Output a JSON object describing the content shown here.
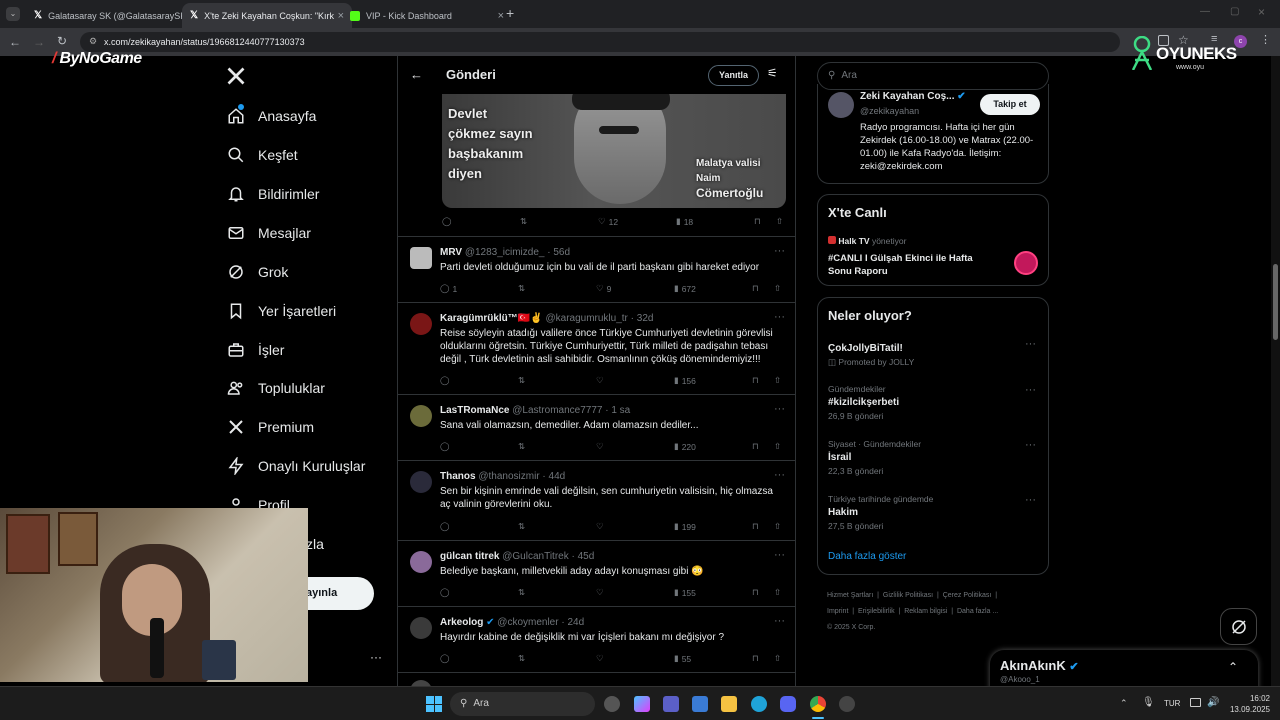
{
  "browser": {
    "tabs": [
      {
        "title": "Galatasaray SK (@GalatasaraySK)",
        "active": false
      },
      {
        "title": "X'te Zeki Kayahan Coşkun: \"Kırk",
        "active": true
      },
      {
        "title": "VIP - Kick Dashboard",
        "active": false
      }
    ],
    "url": "x.com/zekikayahan/status/1966812440777130373"
  },
  "overlays": {
    "bynogame_logo": "ByNoGame",
    "oyuneks_logo": "OYUNEKS",
    "oyuneks_sub": "www.oyu"
  },
  "nav": {
    "items": [
      "Anasayfa",
      "Keşfet",
      "Bildirimler",
      "Mesajlar",
      "Grok",
      "Yer İşaretleri",
      "İşler",
      "Topluluklar",
      "Premium",
      "Onaylı Kuruluşlar",
      "Profil",
      "zla"
    ],
    "post_button": "ayınla",
    "more": "···"
  },
  "main": {
    "header_title": "Gönderi",
    "reply_button": "Yanıtla",
    "image_text_left": [
      "Devlet",
      "çökmez sayın",
      "başbakanım",
      "diyen"
    ],
    "image_text_right": [
      "Malatya valisi",
      "Naim",
      "Cömertoğlu"
    ],
    "post_stats": {
      "likes": "12",
      "views": "18"
    },
    "replies": [
      {
        "name": "MRV",
        "handle": "@1283_icimizde_ · 56d",
        "text": "Parti devleti olduğumuz için bu vali de il parti başkanı gibi hareket ediyor",
        "replies": "1",
        "likes": "9",
        "views": "672"
      },
      {
        "name": "Karagümrüklü™🇹🇷✌",
        "handle": "@karagumruklu_tr · 32d",
        "text": "Reise söyleyin atadığı valilere önce Türkiye Cumhuriyeti devletinin görevlisi olduklarını öğretsin. Türkiye Cumhuriyettir, Türk milleti de padişahın tebası değil , Türk devletinin asli sahibidir. Osmanlının çöküş dönemindemiyiz!!!",
        "replies": "",
        "likes": "",
        "views": "156"
      },
      {
        "name": "LasTRomaNce",
        "handle": "@Lastromance7777 · 1 sa",
        "text": "Sana vali olamazsın, demediler. Adam olamazsın dediler...",
        "replies": "",
        "likes": "",
        "views": "220"
      },
      {
        "name": "Thanos",
        "handle": "@thanosizmir · 44d",
        "text": "Sen bir kişinin emrinde vali değilsin, sen cumhuriyetin valisisin, hiç olmazsa aç valinin görevlerini oku.",
        "replies": "",
        "likes": "",
        "views": "199"
      },
      {
        "name": "gülcan titrek",
        "handle": "@GulcanTitrek · 45d",
        "text": "Belediye başkanı, milletvekili  aday adayı konuşması gibi 😳",
        "replies": "",
        "likes": "",
        "views": "155"
      },
      {
        "name": "Arkeolog",
        "handle": "@ckoymenler · 24d",
        "text": "Hayırdır kabine de değişiklik mi var  İçişleri bakanı mı değişiyor ?",
        "replies": "",
        "likes": "",
        "views": "55"
      }
    ]
  },
  "sidebar": {
    "search_placeholder": "Ara",
    "profile": {
      "name": "Zeki Kayahan Coş...",
      "handle": "@zekikayahan",
      "follow": "Takip et",
      "bio": "Radyo programcısı. Hafta içi her gün Zekirdek (16.00-18.00) ve Matrax (22.00-01.00) ile Kafa Radyo'da. İletişim: zeki@zekirdek.com"
    },
    "live": {
      "title": "X'te Canlı",
      "host": "Halk TV",
      "host_suffix": "yönetiyor",
      "text": "#CANLI I Gülşah Ekinci ile Hafta Sonu Raporu"
    },
    "trends_title": "Neler oluyor?",
    "trends": [
      {
        "category": "",
        "name": "ÇokJollyBiTatil!",
        "meta": "Promoted by JOLLY"
      },
      {
        "category": "Gündemdekiler",
        "name": "#kizilcikşerbeti",
        "meta": "26,9 B gönderi"
      },
      {
        "category": "Siyaset · Gündemdekiler",
        "name": "İsrail",
        "meta": "22,3 B gönderi"
      },
      {
        "category": "Türkiye tarihinde gündemde",
        "name": "Hakim",
        "meta": "27,5 B gönderi"
      }
    ],
    "show_more": "Daha fazla göster",
    "footer": [
      "Hizmet Şartları",
      "Gizlilik Politikası",
      "Çerez Politikası",
      "Imprint",
      "Erişilebilirlik",
      "Reklam bilgisi",
      "Daha fazla ...",
      "© 2025 X Corp."
    ]
  },
  "messages_drawer": {
    "name": "AkınAkınK",
    "handle": "@Akooo_1"
  },
  "taskbar": {
    "search": "Ara",
    "lang": "TUR",
    "time": "16:02",
    "date": "13.09.2025"
  }
}
